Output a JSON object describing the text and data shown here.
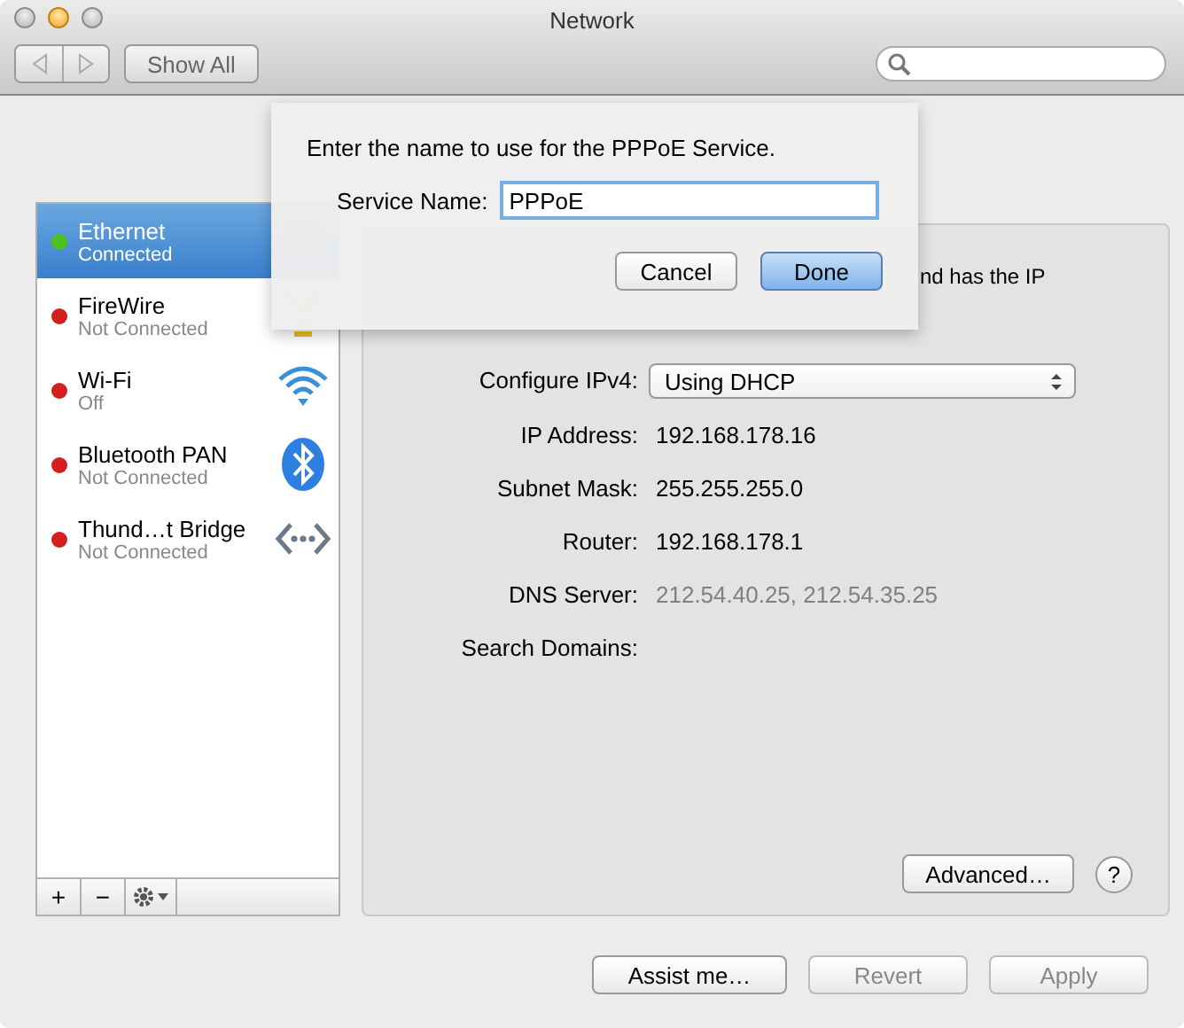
{
  "window": {
    "title": "Network"
  },
  "toolbar": {
    "show_all": "Show All"
  },
  "services": [
    {
      "name": "Ethernet",
      "status": "Connected",
      "color": "#4cc31c",
      "selected": true,
      "kind": "ethernet"
    },
    {
      "name": "FireWire",
      "status": "Not Connected",
      "color": "#d21f1f",
      "selected": false,
      "kind": "firewire"
    },
    {
      "name": "Wi-Fi",
      "status": "Off",
      "color": "#d21f1f",
      "selected": false,
      "kind": "wifi"
    },
    {
      "name": "Bluetooth PAN",
      "status": "Not Connected",
      "color": "#d21f1f",
      "selected": false,
      "kind": "bluetooth"
    },
    {
      "name": "Thund…t Bridge",
      "status": "Not Connected",
      "color": "#d21f1f",
      "selected": false,
      "kind": "bridge"
    }
  ],
  "list_buttons": [
    "+",
    "−"
  ],
  "status_fragment": "nd has the IP",
  "settings": [
    {
      "label": "Configure IPv4:",
      "value": "Using DHCP",
      "kind": "popup"
    },
    {
      "label": "IP Address:",
      "value": "192.168.178.16",
      "kind": "text"
    },
    {
      "label": "Subnet Mask:",
      "value": "255.255.255.0",
      "kind": "text"
    },
    {
      "label": "Router:",
      "value": "192.168.178.1",
      "kind": "text"
    },
    {
      "label": "DNS Server:",
      "value": "212.54.40.25, 212.54.35.25",
      "kind": "dim"
    },
    {
      "label": "Search Domains:",
      "kind": "text"
    }
  ],
  "advanced": "Advanced…",
  "help": "?",
  "footer": [
    {
      "label": "Assist me…",
      "disabled": false
    },
    {
      "label": "Revert",
      "disabled": true
    },
    {
      "label": "Apply",
      "disabled": true
    }
  ],
  "sheet": {
    "prompt": "Enter the name to use for the PPPoE Service.",
    "field_label": "Service Name:",
    "field_value": "PPPoE",
    "buttons": [
      {
        "label": "Cancel",
        "default": false
      },
      {
        "label": "Done",
        "default": true
      }
    ]
  }
}
